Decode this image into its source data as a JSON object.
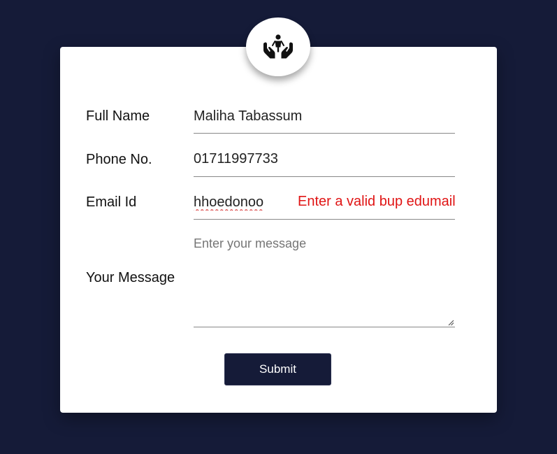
{
  "logo": {
    "icon": "hands-holding-child-icon"
  },
  "form": {
    "full_name": {
      "label": "Full Name",
      "value": "Maliha Tabassum"
    },
    "phone": {
      "label": "Phone No.",
      "value": "01711997733"
    },
    "email": {
      "label": "Email Id",
      "value": "hhoedonoo",
      "error": "Enter a valid bup edumail"
    },
    "message": {
      "label": "Your Message",
      "placeholder": "Enter your message",
      "value": ""
    },
    "submit_label": "Submit"
  },
  "colors": {
    "background": "#151b38",
    "card": "#ffffff",
    "error": "#e01414",
    "button": "#151b38"
  }
}
